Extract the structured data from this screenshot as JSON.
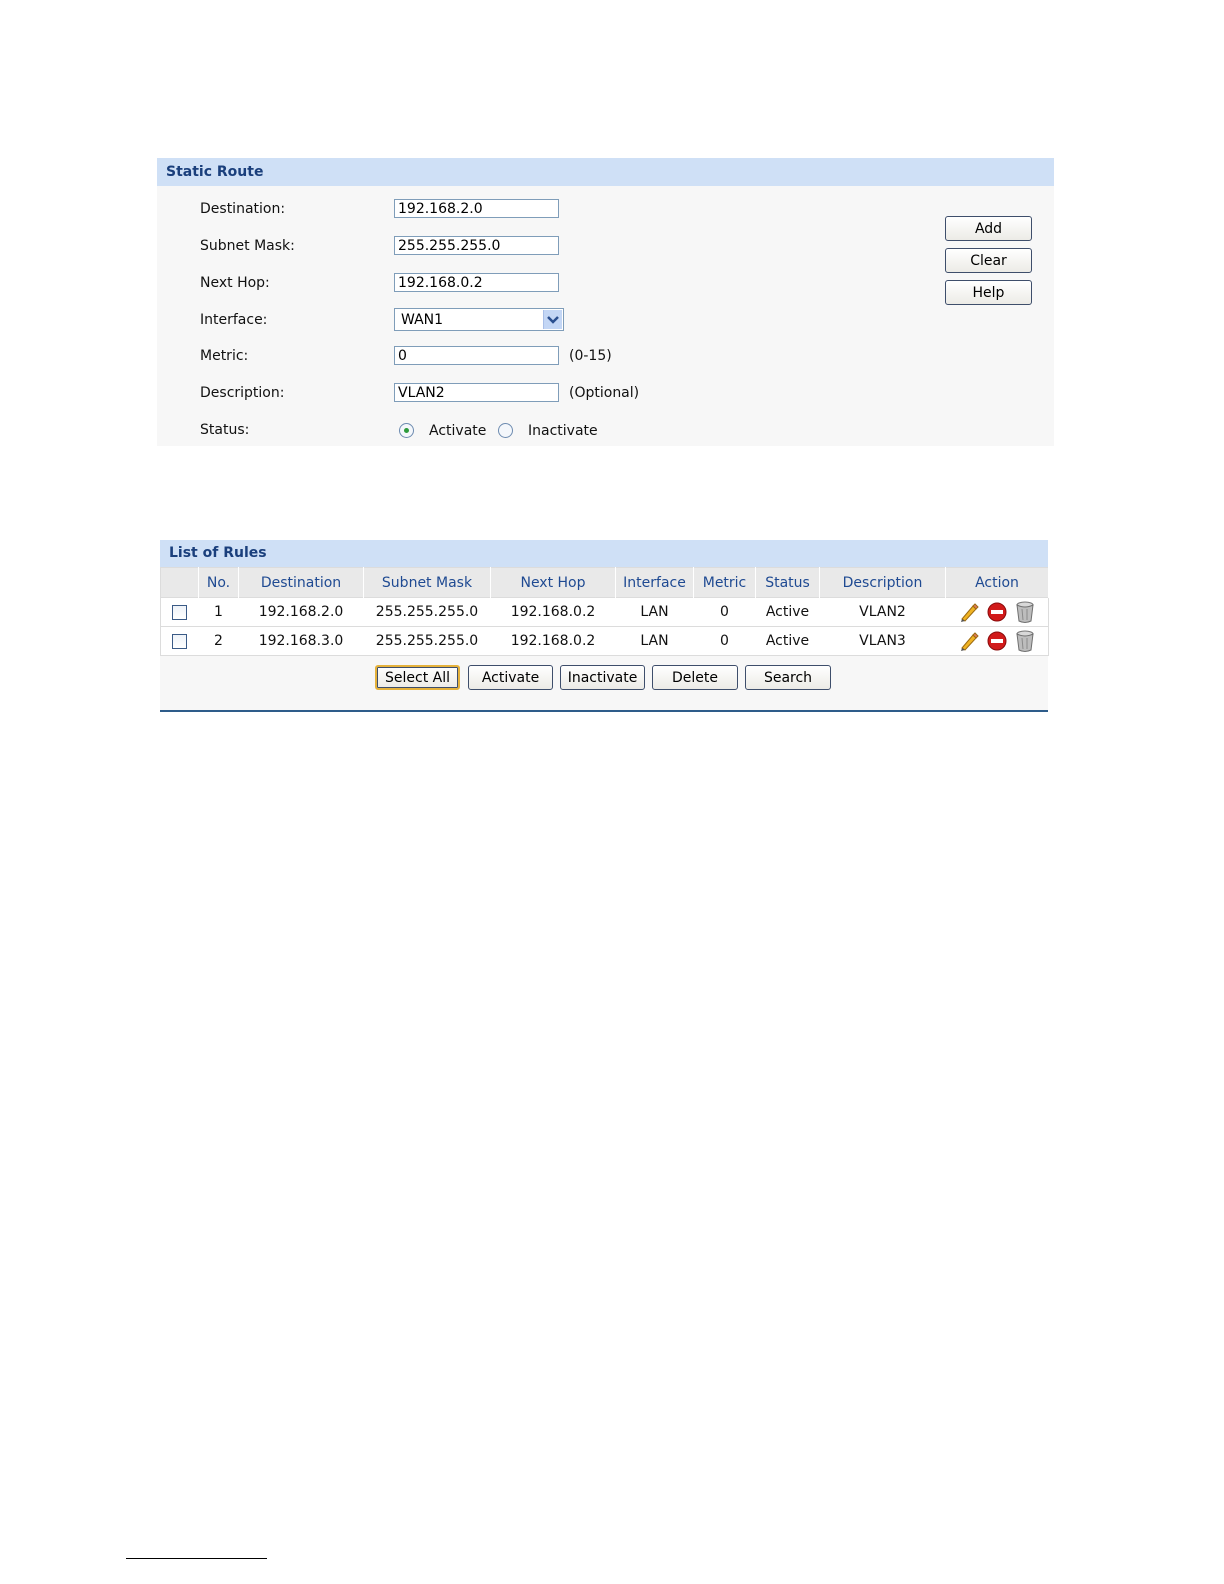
{
  "static_route": {
    "title": "Static Route",
    "fields": {
      "destination": {
        "label": "Destination:",
        "value": "192.168.2.0"
      },
      "subnet_mask": {
        "label": "Subnet Mask:",
        "value": "255.255.255.0"
      },
      "next_hop": {
        "label": "Next Hop:",
        "value": "192.168.0.2"
      },
      "interface": {
        "label": "Interface:",
        "value": "WAN1"
      },
      "metric": {
        "label": "Metric:",
        "value": "0",
        "hint": "(0-15)"
      },
      "description": {
        "label": "Description:",
        "value": "VLAN2",
        "hint": "(Optional)"
      },
      "status": {
        "label": "Status:",
        "options": [
          "Activate",
          "Inactivate"
        ],
        "selected": "Activate"
      }
    },
    "buttons": {
      "add": "Add",
      "clear": "Clear",
      "help": "Help"
    }
  },
  "rules": {
    "title": "List of Rules",
    "columns": [
      "",
      "No.",
      "Destination",
      "Subnet Mask",
      "Next Hop",
      "Interface",
      "Metric",
      "Status",
      "Description",
      "Action"
    ],
    "rows": [
      {
        "no": "1",
        "destination": "192.168.2.0",
        "subnet_mask": "255.255.255.0",
        "next_hop": "192.168.0.2",
        "interface": "LAN",
        "metric": "0",
        "status": "Active",
        "description": "VLAN2"
      },
      {
        "no": "2",
        "destination": "192.168.3.0",
        "subnet_mask": "255.255.255.0",
        "next_hop": "192.168.0.2",
        "interface": "LAN",
        "metric": "0",
        "status": "Active",
        "description": "VLAN3"
      }
    ],
    "action_icons": [
      "edit-pencil-icon",
      "disable-icon",
      "delete-trash-icon"
    ],
    "buttons": {
      "select_all": "Select All",
      "activate": "Activate",
      "inactivate": "Inactivate",
      "delete": "Delete",
      "search": "Search"
    }
  },
  "colors": {
    "header_bg": "#cfe0f6",
    "header_text": "#1a3f7c",
    "panel_bg": "#f7f7f7",
    "divider": "#2e5c8a"
  }
}
